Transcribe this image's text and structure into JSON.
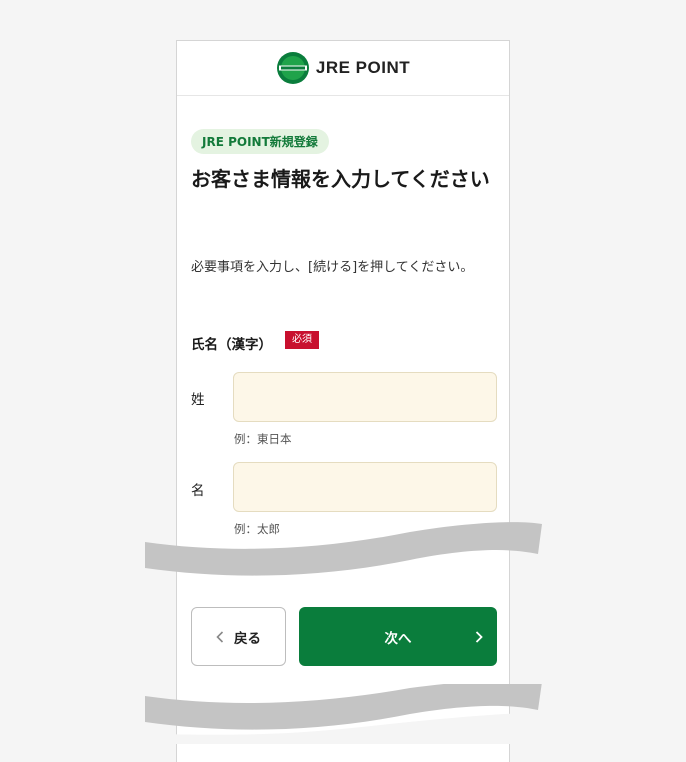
{
  "header": {
    "logo_text": "JRE POINT",
    "logo_mark_text": "JRE POINT"
  },
  "badge": "JRE POINT新規登録",
  "title": "お客さま情報を入力してください",
  "description": "必要事項を入力し、[続ける]を押してください。",
  "form": {
    "field_label": "氏名（漢字）",
    "required_tag": "必須",
    "last_name": {
      "label": "姓",
      "value": "",
      "hint": "例：東日本"
    },
    "first_name": {
      "label": "名",
      "value": "",
      "hint": "例：太郎"
    }
  },
  "buttons": {
    "back": "戻る",
    "next": "次へ"
  },
  "colors": {
    "accent": "#0a7d3c",
    "required": "#c8102e",
    "input_bg": "#fdf7e8",
    "badge_bg": "#e4f3e1"
  }
}
